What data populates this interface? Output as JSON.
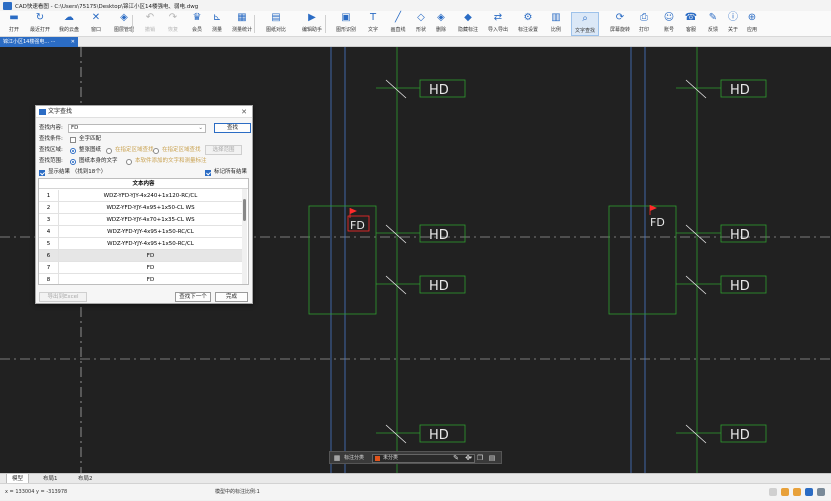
{
  "window": {
    "title": "CAD快速看图 - C:\\Users\\75175\\Desktop\\锦江小区14楼强电、弱电.dwg"
  },
  "toolbar": {
    "items": [
      {
        "label": "打开",
        "icon": "folder-open-icon",
        "glyph": "▬",
        "disabled": false
      },
      {
        "label": "最近打开",
        "icon": "history-icon",
        "glyph": "↻",
        "disabled": false
      },
      {
        "label": "我的云盘",
        "icon": "cloud-icon",
        "glyph": "☁",
        "disabled": false
      },
      {
        "label": "窗口",
        "icon": "window-icon",
        "glyph": "✕",
        "disabled": false
      },
      {
        "label": "图层管理",
        "icon": "layers-icon",
        "glyph": "◈",
        "disabled": false
      },
      {
        "label": "撤销",
        "icon": "undo-icon",
        "glyph": "↶",
        "disabled": true
      },
      {
        "label": "恢复",
        "icon": "redo-icon",
        "glyph": "↷",
        "disabled": true
      },
      {
        "label": "会员",
        "icon": "vip-icon",
        "glyph": "♛",
        "disabled": false
      },
      {
        "label": "测量",
        "icon": "measure-icon",
        "glyph": "⊾",
        "disabled": false
      },
      {
        "label": "测量统计",
        "icon": "measure-stats-icon",
        "glyph": "▦",
        "disabled": false
      },
      {
        "label": "图纸对比",
        "icon": "compare-icon",
        "glyph": "▤",
        "disabled": false
      },
      {
        "label": "编辑助手",
        "icon": "edit-assistant-icon",
        "glyph": "▶",
        "disabled": false
      },
      {
        "label": "图形识别",
        "icon": "shape-recognize-icon",
        "glyph": "▣",
        "disabled": false
      },
      {
        "label": "文字",
        "icon": "text-icon",
        "glyph": "T",
        "disabled": false
      },
      {
        "label": "画直线",
        "icon": "line-icon",
        "glyph": "╱",
        "disabled": false
      },
      {
        "label": "形状",
        "icon": "shape-icon",
        "glyph": "◇",
        "disabled": false
      },
      {
        "label": "删除",
        "icon": "delete-icon",
        "glyph": "◈",
        "disabled": false
      },
      {
        "label": "隐藏标注",
        "icon": "hide-annotation-icon",
        "glyph": "◆",
        "disabled": false
      },
      {
        "label": "导入导出",
        "icon": "import-export-icon",
        "glyph": "⇄",
        "disabled": false
      },
      {
        "label": "标注设置",
        "icon": "annotation-settings-icon",
        "glyph": "⚙",
        "disabled": false
      },
      {
        "label": "比例",
        "icon": "scale-icon",
        "glyph": "▥",
        "disabled": false
      },
      {
        "label": "文字查找",
        "icon": "text-search-icon",
        "glyph": "⌕",
        "disabled": false,
        "active": true
      },
      {
        "label": "屏幕旋转",
        "icon": "rotate-screen-icon",
        "glyph": "⟳",
        "disabled": false
      },
      {
        "label": "打印",
        "icon": "print-icon",
        "glyph": "⎙",
        "disabled": false
      },
      {
        "label": "账号",
        "icon": "account-icon",
        "glyph": "☺",
        "disabled": false
      },
      {
        "label": "客服",
        "icon": "support-icon",
        "glyph": "☎",
        "disabled": false
      },
      {
        "label": "反馈",
        "icon": "feedback-icon",
        "glyph": "✎",
        "disabled": false
      },
      {
        "label": "关于",
        "icon": "about-icon",
        "glyph": "ⓘ",
        "disabled": false
      },
      {
        "label": "应用",
        "icon": "apps-icon",
        "glyph": "⊕",
        "disabled": false
      }
    ]
  },
  "doc_tab": {
    "label": "锦江小区14楼强电... ···",
    "close": "✕"
  },
  "drawing": {
    "labels": {
      "hd": "HD",
      "fd": "FD"
    }
  },
  "dialog": {
    "title": "文字查找",
    "close": "✕",
    "search_label": "查找内容:",
    "search_value": "FD",
    "search_button": "查找",
    "condition_label": "查找条件:",
    "full_match": "全字匹配",
    "area_label": "查找区域:",
    "area_options": [
      "整张图纸",
      "在指定区域查找",
      "在指定区域查找"
    ],
    "select_area_button": "选择范围",
    "range_label": "查找范围:",
    "range_options": [
      "图纸本身的文字",
      "本软件添加的文字和测量标注"
    ],
    "show_results": "显示结果 （找到18个）",
    "mark_all": "标记所有结果",
    "table": {
      "header": "文本内容",
      "rows": [
        {
          "n": "1",
          "text": "WDZ-YFD-YJY-4x240+1x120-RC/CL"
        },
        {
          "n": "2",
          "text": "WDZ-YFD-YJY-4x95+1x50-CL WS"
        },
        {
          "n": "3",
          "text": "WDZ-YFD-YJY-4x70+1x35-CL WS"
        },
        {
          "n": "4",
          "text": "WDZ-YFD-YJY-4x95+1x50-RC/CL"
        },
        {
          "n": "5",
          "text": "WDZ-YFD-YJY-4x95+1x50-RC/CL"
        },
        {
          "n": "6",
          "text": "FD"
        },
        {
          "n": "7",
          "text": "FD"
        },
        {
          "n": "8",
          "text": "FD"
        }
      ],
      "selected_index": 5
    },
    "export_button": "导出到Excel",
    "find_next_button": "查找下一个",
    "done_button": "完成"
  },
  "float_toolbar": {
    "label": "标注分类",
    "category": "未分类"
  },
  "layout_tabs": [
    "模型",
    "布局1",
    "布局2"
  ],
  "status": {
    "coords": "x = 133004  y = -313978",
    "scale": "模型中的标注比例:1"
  },
  "colors": {
    "accent": "#2b6cc4",
    "canvas": "#212121",
    "cad_green": "#2f9e2f",
    "cad_white": "#e8e8e8",
    "marker_red": "#ff2a2a"
  }
}
